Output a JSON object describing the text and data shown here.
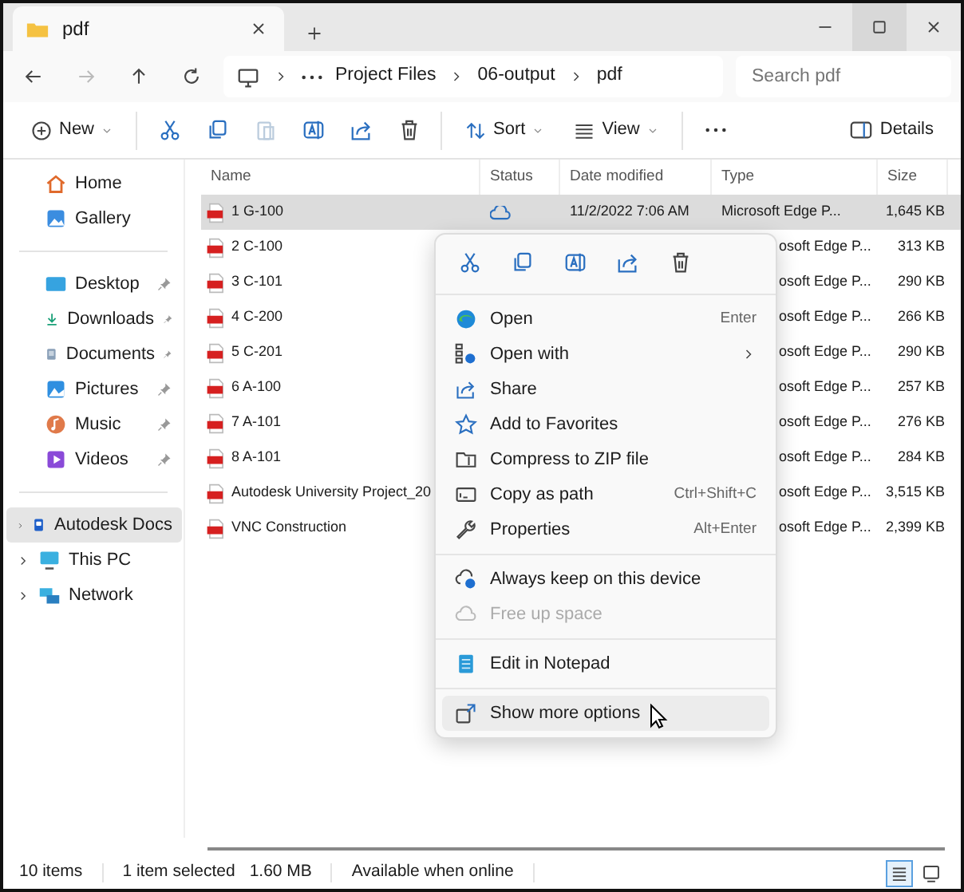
{
  "tab": {
    "title": "pdf"
  },
  "address": {
    "crumbs": [
      "Project Files",
      "06-output",
      "pdf"
    ]
  },
  "search": {
    "placeholder": "Search pdf"
  },
  "toolbar": {
    "new": "New",
    "sort": "Sort",
    "view": "View",
    "details": "Details"
  },
  "sidebar": {
    "quick": [
      {
        "label": "Home",
        "pinned": false
      },
      {
        "label": "Gallery",
        "pinned": false
      }
    ],
    "pinned": [
      {
        "label": "Desktop",
        "pinned": true
      },
      {
        "label": "Downloads",
        "pinned": true
      },
      {
        "label": "Documents",
        "pinned": true
      },
      {
        "label": "Pictures",
        "pinned": true
      },
      {
        "label": "Music",
        "pinned": true
      },
      {
        "label": "Videos",
        "pinned": true
      }
    ],
    "tree": [
      {
        "label": "Autodesk Docs",
        "selected": true,
        "expanded": false
      },
      {
        "label": "This PC",
        "selected": false,
        "expanded": false
      },
      {
        "label": "Network",
        "selected": false,
        "expanded": false
      }
    ]
  },
  "table": {
    "columns": [
      "Name",
      "Status",
      "Date modified",
      "Type",
      "Size"
    ],
    "rows": [
      {
        "name": "1 G-100",
        "date": "11/2/2022 7:06 AM",
        "type": "Microsoft Edge P...",
        "size": "1,645 KB",
        "selected": true,
        "under_menu": false
      },
      {
        "name": "2 C-100",
        "type": "osoft Edge P...",
        "size": "313 KB",
        "selected": false,
        "under_menu": true
      },
      {
        "name": "3 C-101",
        "type": "osoft Edge P...",
        "size": "290 KB",
        "selected": false,
        "under_menu": true
      },
      {
        "name": "4 C-200",
        "type": "osoft Edge P...",
        "size": "266 KB",
        "selected": false,
        "under_menu": true
      },
      {
        "name": "5 C-201",
        "type": "osoft Edge P...",
        "size": "290 KB",
        "selected": false,
        "under_menu": true
      },
      {
        "name": "6 A-100",
        "type": "osoft Edge P...",
        "size": "257 KB",
        "selected": false,
        "under_menu": true
      },
      {
        "name": "7 A-101",
        "type": "osoft Edge P...",
        "size": "276 KB",
        "selected": false,
        "under_menu": true
      },
      {
        "name": "8 A-101",
        "type": "osoft Edge P...",
        "size": "284 KB",
        "selected": false,
        "under_menu": true
      },
      {
        "name": "Autodesk University Project_20",
        "type": "osoft Edge P...",
        "size": "3,515 KB",
        "selected": false,
        "under_menu": true
      },
      {
        "name": "VNC Construction",
        "type": "osoft Edge P...",
        "size": "2,399 KB",
        "selected": false,
        "under_menu": true
      }
    ]
  },
  "context_menu": {
    "groups": [
      [
        {
          "label": "Open",
          "shortcut": "Enter",
          "submenu": false,
          "disabled": false,
          "selected": false
        },
        {
          "label": "Open with",
          "submenu": true,
          "disabled": false,
          "selected": false
        },
        {
          "label": "Share",
          "submenu": false,
          "disabled": false,
          "selected": false
        },
        {
          "label": "Add to Favorites",
          "submenu": false,
          "disabled": false,
          "selected": false
        },
        {
          "label": "Compress to ZIP file",
          "submenu": false,
          "disabled": false,
          "selected": false
        },
        {
          "label": "Copy as path",
          "shortcut": "Ctrl+Shift+C",
          "submenu": false,
          "disabled": false,
          "selected": false
        },
        {
          "label": "Properties",
          "shortcut": "Alt+Enter",
          "submenu": false,
          "disabled": false,
          "selected": false
        }
      ],
      [
        {
          "label": "Always keep on this device",
          "submenu": false,
          "disabled": false,
          "selected": false
        },
        {
          "label": "Free up space",
          "submenu": false,
          "disabled": true,
          "selected": false
        }
      ],
      [
        {
          "label": "Edit in Notepad",
          "submenu": false,
          "disabled": false,
          "selected": false
        }
      ],
      [
        {
          "label": "Show more options",
          "submenu": false,
          "disabled": false,
          "selected": true
        }
      ]
    ]
  },
  "status_bar": {
    "texts": [
      "10 items",
      "1 item selected",
      "1.60 MB",
      "Available when online"
    ],
    "views": [
      {
        "selected": true
      },
      {
        "selected": false
      }
    ]
  }
}
